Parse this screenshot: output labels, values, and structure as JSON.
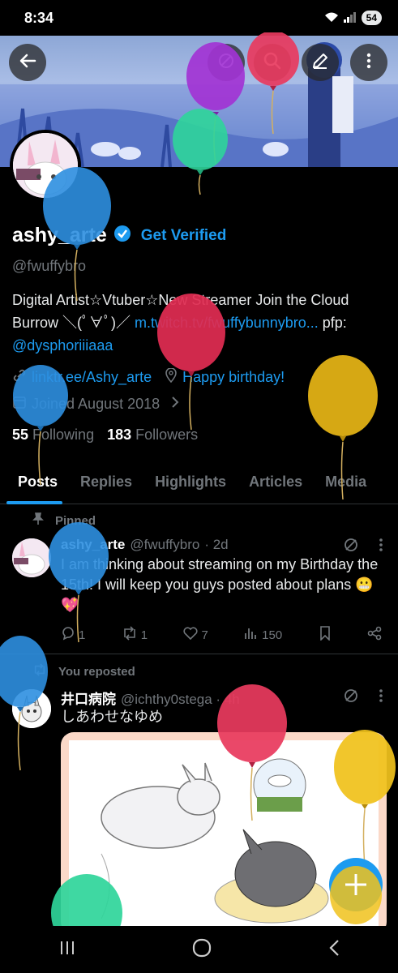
{
  "status": {
    "time": "8:34",
    "battery": "54"
  },
  "profile": {
    "display_name": "ashy_arte",
    "get_verified": "Get Verified",
    "handle": "@fwuffybro",
    "bio_text": "Digital Artist☆Vtuber☆New Streamer Join the Cloud Burrow ＼(ﾟ∀ﾟ)／ ",
    "bio_link": "m.twitch.tv/fwuffybunnybro...",
    "bio_pfp": " pfp:",
    "bio_mention": "@dysphoriiiaaa",
    "website": "linktr.ee/Ashy_arte",
    "location": "Happy birthday!",
    "joined": "Joined August 2018",
    "following_count": "55",
    "following_label": "Following",
    "followers_count": "183",
    "followers_label": "Followers"
  },
  "tabs": [
    "Posts",
    "Replies",
    "Highlights",
    "Articles",
    "Media"
  ],
  "posts": [
    {
      "context": "Pinned",
      "name": "ashy_arte",
      "handle": "@fwuffybro",
      "time": "· 2d",
      "text": "I am thinking about streaming on my Birthday the 15th! I will keep you guys posted about plans 😬💖",
      "replies": "1",
      "reposts": "1",
      "likes": "7",
      "views": "150"
    },
    {
      "context": "You reposted",
      "name": "井口病院",
      "handle": "@ichthy0stega · 4h",
      "text": "しあわせなゆめ"
    }
  ],
  "icons": {
    "back": "back-arrow-icon",
    "search": "search-icon",
    "edit": "edit-icon",
    "more": "more-icon"
  },
  "colors": {
    "accent": "#1d9bf0",
    "background": "#000000"
  }
}
